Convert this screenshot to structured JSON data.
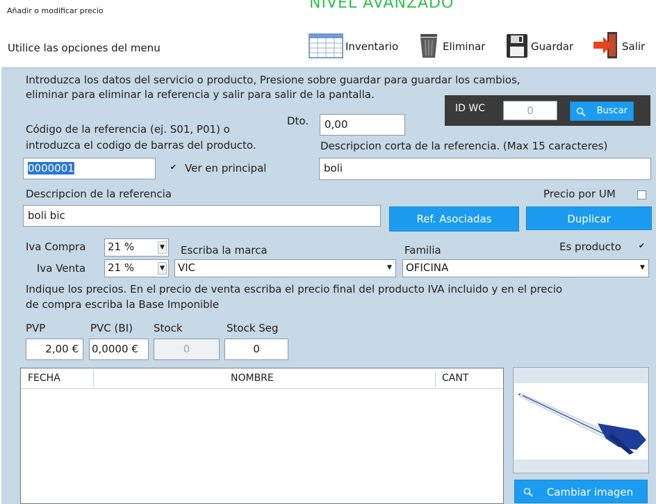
{
  "overlay_text": "NIVEL AVANZADO",
  "window_title": "Añadir o modificar precio",
  "menu_caption": "Utilice las opciones del menu",
  "toolbar": {
    "inventario": "Inventario",
    "eliminar": "Eliminar",
    "guardar": "Guardar",
    "salir": "Salir"
  },
  "instructions": {
    "line1": "Introduzca los datos del servicio o producto, Presione sobre guardar para guardar los cambios,",
    "line2": "eliminar para eliminar la referencia y salir para salir de la pantalla."
  },
  "idwc": {
    "label": "ID WC",
    "value": "0",
    "search_button": "Buscar"
  },
  "discount": {
    "label": "Dto.",
    "value": "0,00"
  },
  "code": {
    "label_line1": "Código de la referencia (ej. S01, P01) o",
    "label_line2": "introduzca el codigo de barras del producto.",
    "value": "0000001"
  },
  "show_in_main": {
    "label": "Ver en principal",
    "checked": true
  },
  "short_description": {
    "label": "Descripcion corta de la referencia. (Max 15 caracteres)",
    "value": "boli"
  },
  "description": {
    "label": "Descripcion de la referencia",
    "value": "boli bic"
  },
  "price_per_um": {
    "label": "Precio por UM",
    "checked": false
  },
  "buttons": {
    "associated_refs": "Ref. Asociadas",
    "duplicate": "Duplicar",
    "change_image": "Cambiar imagen"
  },
  "iva_compra": {
    "label": "Iva Compra",
    "value": "21 %"
  },
  "iva_venta": {
    "label": "Iva Venta",
    "value": "21 %"
  },
  "brand": {
    "label": "Escriba la marca",
    "value": "VIC"
  },
  "family": {
    "label": "Familia",
    "value": "OFICINA"
  },
  "is_product": {
    "label": "Es producto",
    "checked": true
  },
  "prices_instructions": {
    "line1": "Indique los precios. En el precio de venta escriba el precio final del producto IVA incluido y en el precio",
    "line2": "de compra escriba la Base Imponible"
  },
  "prices": {
    "pvp_label": "PVP",
    "pvp_value": "2,00 €",
    "pvc_label": "PVC (BI)",
    "pvc_value": "0,0000 €",
    "stock_label": "Stock",
    "stock_value": "0",
    "stock_seg_label": "Stock Seg",
    "stock_seg_value": "0"
  },
  "grid": {
    "columns": [
      "FECHA",
      "NOMBRE",
      "CANT"
    ],
    "rows": []
  },
  "colors": {
    "panel": "#c7d8e6",
    "accent": "#1b9cf0",
    "overlay": "#2ec34a"
  },
  "icons": [
    "inventory-grid-icon",
    "trash-icon",
    "floppy-disk-icon",
    "exit-arrow-icon",
    "search-icon",
    "pen-image"
  ]
}
